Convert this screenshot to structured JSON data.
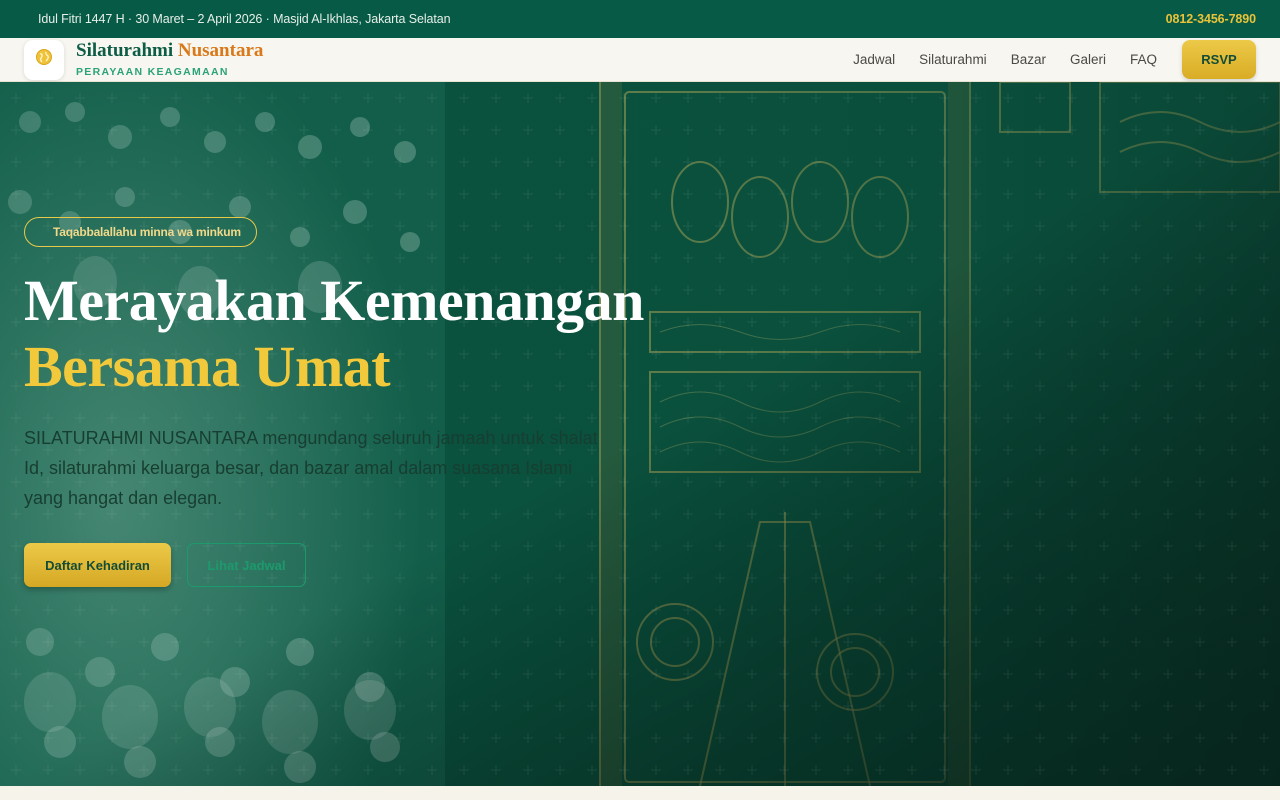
{
  "topbar": {
    "event_info": "Idul Fitri 1447 H · 30 Maret – 2 April 2026 · Masjid Al-Ikhlas, Jakarta Selatan",
    "phone": "0812-3456-7890"
  },
  "brand": {
    "name_part1": "Silaturahmi",
    "name_part2": "Nusantara",
    "tagline": "PERAYAAN KEAGAMAAN",
    "logo_icon": "globe-icon"
  },
  "nav": {
    "items": [
      {
        "label": "Jadwal"
      },
      {
        "label": "Silaturahmi"
      },
      {
        "label": "Bazar"
      },
      {
        "label": "Galeri"
      },
      {
        "label": "FAQ"
      }
    ],
    "rsvp_label": "RSVP"
  },
  "hero": {
    "pill": "Taqabbalallahu minna wa minkum",
    "title_line1": "Merayakan Kemenangan",
    "title_line2": "Bersama Umat",
    "lead": "SILATURAHMI NUSANTARA mengundang seluruh jamaah untuk shalat Id, silaturahmi keluarga besar, dan bazar amal dalam suasana Islami yang hangat dan elegan.",
    "primary_cta": "Daftar Kehadiran",
    "secondary_cta": "Lihat Jadwal"
  },
  "colors": {
    "primary_green": "#075a45",
    "gold": "#f1c93b",
    "accent_orange": "#d9791a",
    "teal": "#2aa27a"
  }
}
